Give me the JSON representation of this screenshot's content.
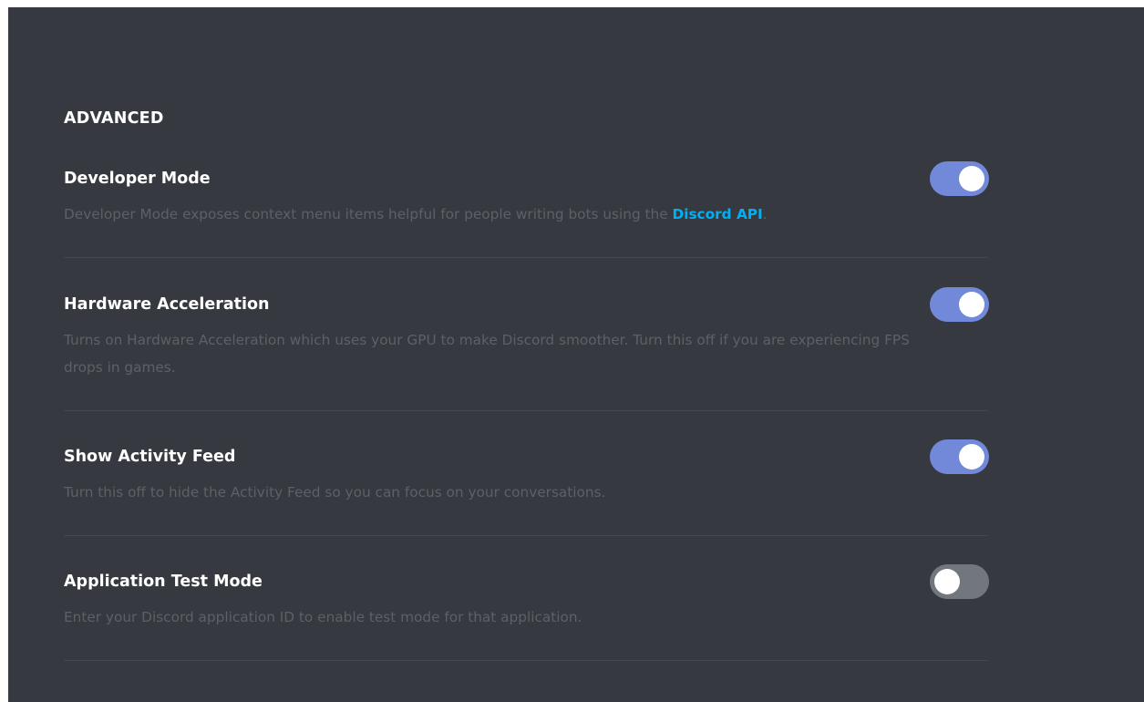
{
  "section": {
    "title": "ADVANCED"
  },
  "settings": [
    {
      "title": "Developer Mode",
      "description_prefix": "Developer Mode exposes context menu items helpful for people writing bots using the ",
      "link_text": "Discord API",
      "description_suffix": ".",
      "enabled": true
    },
    {
      "title": "Hardware Acceleration",
      "description": "Turns on Hardware Acceleration which uses your GPU to make Discord smoother. Turn this off if you are experiencing FPS drops in games.",
      "enabled": true
    },
    {
      "title": "Show Activity Feed",
      "description": "Turn this off to hide the Activity Feed so you can focus on your conversations.",
      "enabled": true
    },
    {
      "title": "Application Test Mode",
      "description": "Enter your Discord application ID to enable test mode for that application.",
      "enabled": false
    }
  ],
  "colors": {
    "background": "#36393f",
    "toggle_on": "#7289da",
    "toggle_off": "#72767d",
    "link": "#00b0f4",
    "description": "#5d6066"
  },
  "icons": {
    "toggle_knob": "toggle-knob-icon"
  }
}
